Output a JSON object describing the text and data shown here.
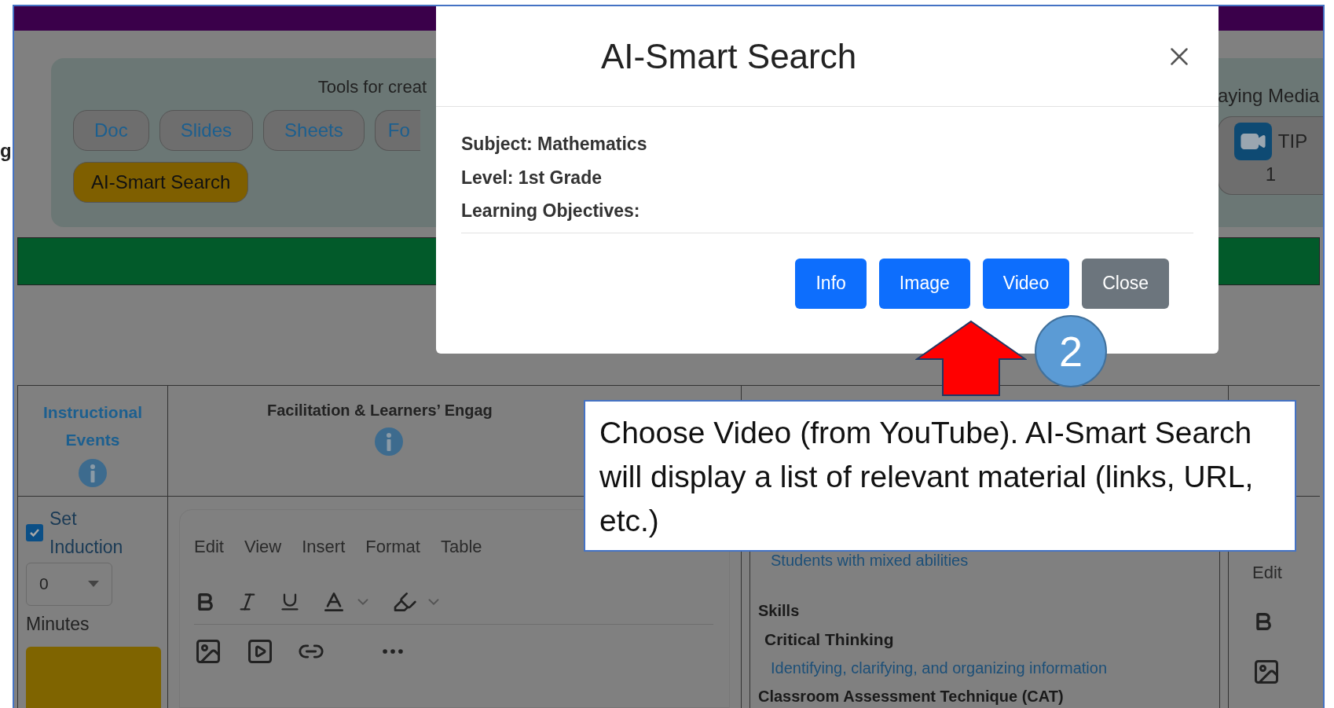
{
  "background_page": {
    "edge_text": "g"
  },
  "tools": {
    "caption_left": "Tools for creat",
    "caption_right": "aying Media",
    "buttons": [
      {
        "label": "Doc"
      },
      {
        "label": "Slides"
      },
      {
        "label": "Sheets"
      },
      {
        "label": "Fo"
      }
    ],
    "smart_search_button": "AI-Smart Search",
    "tip_button": {
      "label": "TIP",
      "count": "1"
    }
  },
  "table": {
    "columns": [
      {
        "heading": "Instructional Events"
      },
      {
        "heading": "Facilitation & Learners’ Engag"
      }
    ],
    "event": {
      "label": "Set Induction",
      "checked": true,
      "minutes_value": "0",
      "minutes_label": "Minutes"
    },
    "editor": {
      "menus": [
        "Edit",
        "View",
        "Insert",
        "Format",
        "Table"
      ]
    },
    "column_3": {
      "lines": [
        {
          "text": "Students with mixed abilities",
          "kind": "link"
        },
        {
          "text": "Skills",
          "kind": "heading"
        },
        {
          "text": "Critical Thinking",
          "kind": "subheading"
        },
        {
          "text": "Identifying, clarifying, and organizing information",
          "kind": "link"
        },
        {
          "text": "Classroom Assessment Technique (CAT)",
          "kind": "heading"
        }
      ]
    },
    "column_4": {
      "menu": "Edit"
    }
  },
  "modal": {
    "title": "AI-Smart Search",
    "lines": [
      "Subject: Mathematics",
      "Level: 1st Grade",
      "Learning Objectives:"
    ],
    "buttons": [
      {
        "label": "Info",
        "kind": "primary"
      },
      {
        "label": "Image",
        "kind": "primary"
      },
      {
        "label": "Video",
        "kind": "primary"
      },
      {
        "label": "Close",
        "kind": "secondary"
      }
    ]
  },
  "annotation": {
    "step": "2",
    "text": "Choose Video (from YouTube). AI-Smart Search will display a list of relevant material (links, URL, etc.)"
  }
}
